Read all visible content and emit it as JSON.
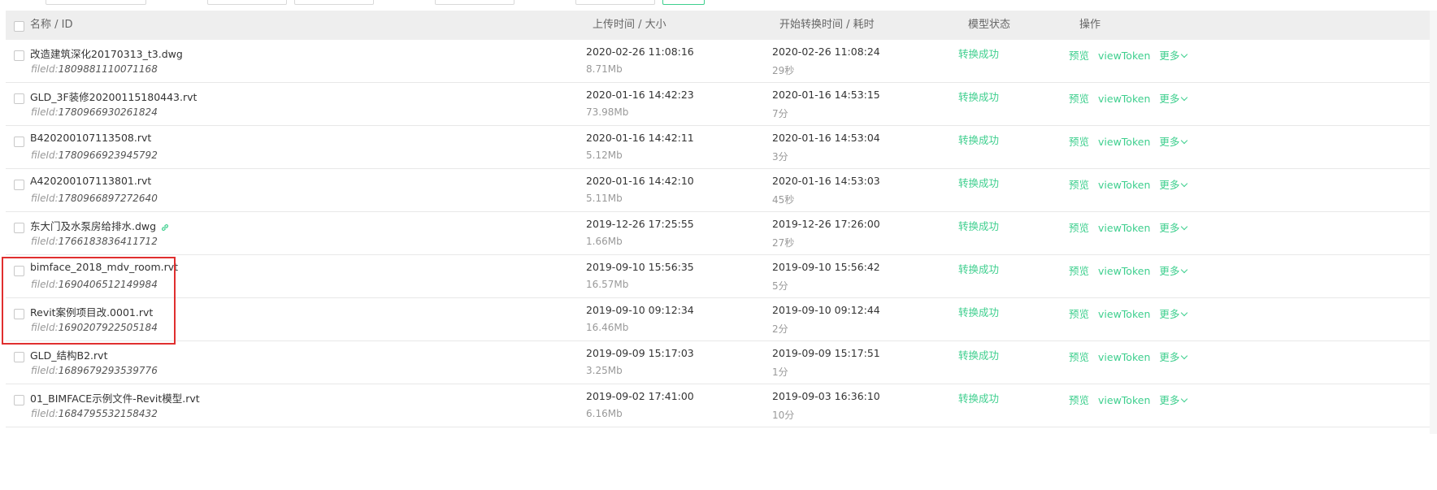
{
  "header": {
    "name_id": "名称 / ID",
    "upload": "上传时间 / 大小",
    "start": "开始转换时间 / 耗时",
    "status": "模型状态",
    "ops": "操作"
  },
  "labels": {
    "fileid_prefix": "fileId:"
  },
  "actions": {
    "preview": "预览",
    "view_token": "viewToken",
    "more": "更多"
  },
  "accent_color": "#3ecf8e",
  "highlight_color": "#e02f2f",
  "rows": [
    {
      "name": "改造建筑深化20170313_t3.dwg",
      "file_id": "1809881110071168",
      "upload_time": "2020-02-26 11:08:16",
      "size": "8.71Mb",
      "start_time": "2020-02-26 11:08:24",
      "duration": "29秒",
      "status": "转换成功"
    },
    {
      "name": "GLD_3F装修20200115180443.rvt",
      "file_id": "1780966930261824",
      "upload_time": "2020-01-16 14:42:23",
      "size": "73.98Mb",
      "start_time": "2020-01-16 14:53:15",
      "duration": "7分",
      "status": "转换成功"
    },
    {
      "name": "B420200107113508.rvt",
      "file_id": "1780966923945792",
      "upload_time": "2020-01-16 14:42:11",
      "size": "5.12Mb",
      "start_time": "2020-01-16 14:53:04",
      "duration": "3分",
      "status": "转换成功"
    },
    {
      "name": "A420200107113801.rvt",
      "file_id": "1780966897272640",
      "upload_time": "2020-01-16 14:42:10",
      "size": "5.11Mb",
      "start_time": "2020-01-16 14:53:03",
      "duration": "45秒",
      "status": "转换成功"
    },
    {
      "name": "东大门及水泵房给排水.dwg",
      "file_id": "1766183836411712",
      "upload_time": "2019-12-26 17:25:55",
      "size": "1.66Mb",
      "start_time": "2019-12-26 17:26:00",
      "duration": "27秒",
      "status": "转换成功",
      "has_link_icon": true
    },
    {
      "name": "bimface_2018_mdv_room.rvt",
      "file_id": "1690406512149984",
      "upload_time": "2019-09-10 15:56:35",
      "size": "16.57Mb",
      "start_time": "2019-09-10 15:56:42",
      "duration": "5分",
      "status": "转换成功"
    },
    {
      "name": "Revit案例项目改.0001.rvt",
      "file_id": "1690207922505184",
      "upload_time": "2019-09-10 09:12:34",
      "size": "16.46Mb",
      "start_time": "2019-09-10 09:12:44",
      "duration": "2分",
      "status": "转换成功"
    },
    {
      "name": "GLD_结构B2.rvt",
      "file_id": "1689679293539776",
      "upload_time": "2019-09-09 15:17:03",
      "size": "3.25Mb",
      "start_time": "2019-09-09 15:17:51",
      "duration": "1分",
      "status": "转换成功"
    },
    {
      "name": "01_BIMFACE示例文件-Revit模型.rvt",
      "file_id": "1684795532158432",
      "upload_time": "2019-09-02 17:41:00",
      "size": "6.16Mb",
      "start_time": "2019-09-03 16:36:10",
      "duration": "10分",
      "status": "转换成功"
    }
  ]
}
